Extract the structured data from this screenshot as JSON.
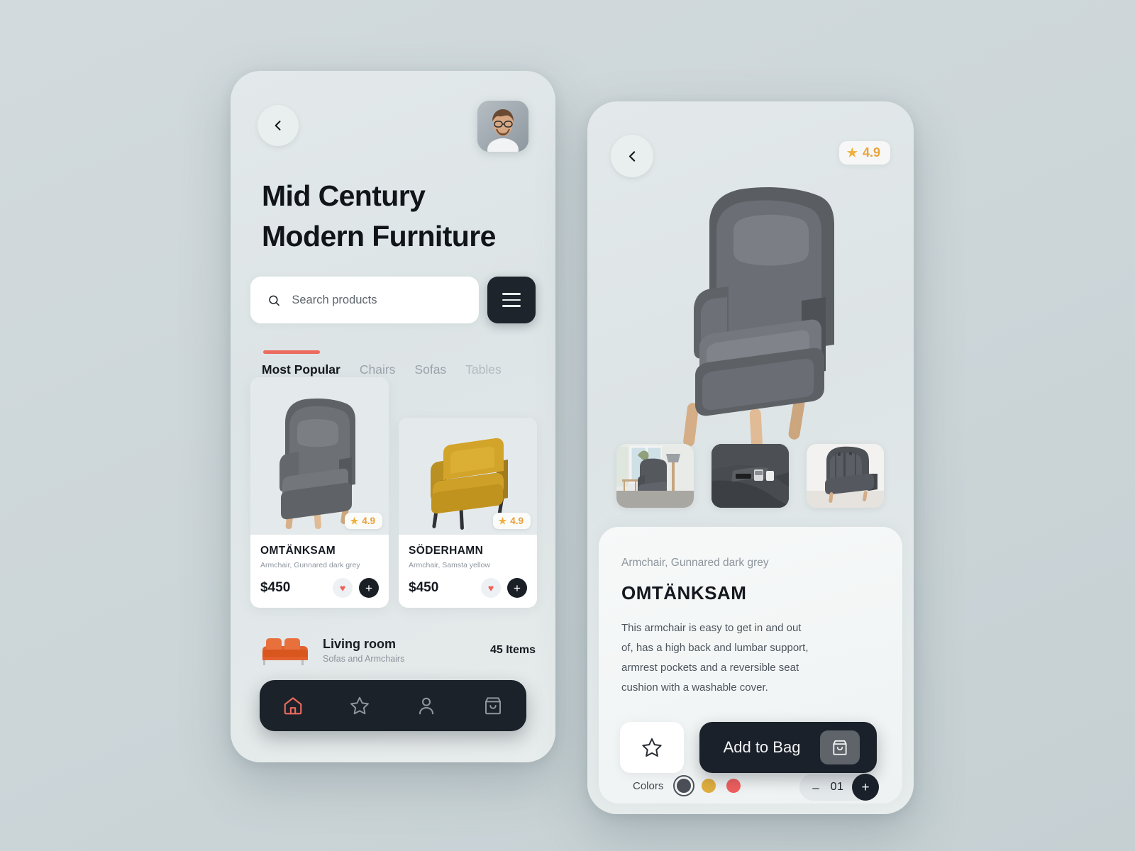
{
  "theme": {
    "background": "#ccd5d8",
    "phone_surface": "#dde4e6",
    "accent_red": "#ed6a5e",
    "dark": "#1b212a",
    "star_gold": "#efb03c"
  },
  "home": {
    "back_icon": "chevron-left-icon",
    "avatar_alt": "user-avatar",
    "title": "Mid Century\nModern Furniture",
    "title_line1": "Mid Century",
    "title_line2": "Modern Furniture",
    "search": {
      "placeholder": "Search products",
      "value": "",
      "icon": "search-icon"
    },
    "menu_icon": "hamburger-menu-icon",
    "tabs": [
      {
        "label": "Most Popular",
        "active": true
      },
      {
        "label": "Chairs",
        "active": false
      },
      {
        "label": "Sofas",
        "active": false
      },
      {
        "label": "Tables",
        "active": false
      }
    ],
    "products": [
      {
        "name": "OMTÄNKSAM",
        "subtitle": "Armchair, Gunnared dark grey",
        "price": "$450",
        "rating": "4.9",
        "color": "#6e7378",
        "favorite_icon": "heart-icon",
        "add_icon": "plus-icon"
      },
      {
        "name": "SÖDERHAMN",
        "subtitle": "Armchair, Samsta yellow",
        "price": "$450",
        "rating": "4.9",
        "color": "#d4a428",
        "favorite_icon": "heart-icon",
        "add_icon": "plus-icon"
      }
    ],
    "category_row": {
      "title": "Living room",
      "subtitle": "Sofas and Armchairs",
      "count": "45 Items",
      "thumb_icon": "sofa-thumbnail"
    },
    "nav_items": [
      {
        "icon": "home-icon",
        "active": true
      },
      {
        "icon": "star-icon",
        "active": false
      },
      {
        "icon": "user-icon",
        "active": false
      },
      {
        "icon": "bag-icon",
        "active": false
      }
    ]
  },
  "detail": {
    "back_icon": "chevron-left-icon",
    "rating": "4.9",
    "rating_star_icon": "star-icon",
    "hero_alt": "armchair-hero-image",
    "thumbnails": [
      {
        "alt": "armchair-in-room-thumbnail"
      },
      {
        "alt": "armrest-pocket-detail-thumbnail"
      },
      {
        "alt": "armchair-back-view-thumbnail"
      }
    ],
    "subtitle": "Armchair, Gunnared dark grey",
    "name": "OMTÄNKSAM",
    "description": "This armchair is easy to get in and out of, has a high back and lumbar support, armrest pockets and a reversible seat cushion with a washable cover.",
    "colors_label": "Colors",
    "colors": [
      {
        "name": "dark-grey",
        "hex": "#4a4f57",
        "selected": true
      },
      {
        "name": "gold-yellow",
        "hex": "#dfae3e",
        "selected": false
      },
      {
        "name": "coral-red",
        "hex": "#ef5f5f",
        "selected": false
      }
    ],
    "quantity": {
      "minus_label": "–",
      "value": "01",
      "plus_label": "+"
    },
    "favorite_icon": "star-outline-icon",
    "cta": {
      "label": "Add to Bag",
      "icon": "shopping-bag-icon"
    }
  }
}
